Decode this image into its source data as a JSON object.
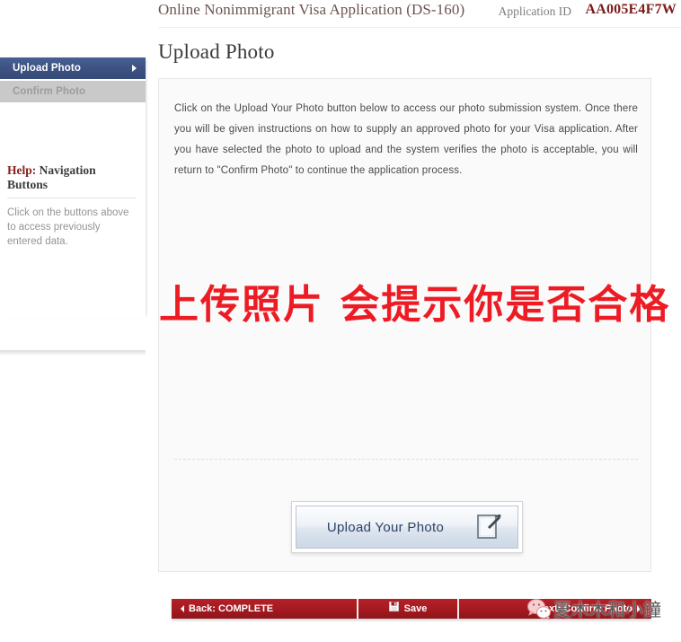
{
  "header": {
    "title": "Online Nonimmigrant Visa Application (DS-160)",
    "app_id_label": "Application ID",
    "app_id_value": "AA005E4F7W"
  },
  "sidebar": {
    "nav_items": [
      {
        "label": "Upload Photo",
        "state": "active"
      },
      {
        "label": "Confirm Photo",
        "state": "disabled"
      }
    ],
    "help": {
      "title_accent": "Help:",
      "title_rest": " Navigation Buttons",
      "body": "Click on the buttons above to access previously entered data."
    }
  },
  "main": {
    "page_title": "Upload Photo",
    "instructions": "Click on the Upload Your Photo button below to access our photo submission system. Once there you will be given instructions on how to supply an approved photo for your Visa application. After you have selected the photo to upload and the system verifies the photo is acceptable, you will return to \"Confirm Photo\" to continue the application process.",
    "overlay_note": "上传照片  会提示你是否合格",
    "upload_button_label": "Upload Your Photo"
  },
  "toolbar": {
    "back_label": "Back: COMPLETE",
    "save_label": "Save",
    "next_label": "Next: Confirm Photo"
  },
  "watermark": {
    "text": "夏木木和小鐘"
  },
  "colors": {
    "nav_active": "#3d5283",
    "nav_disabled": "#c9c9c9",
    "toolbar_red": "#a31a20",
    "app_id_red": "#7c1b1b",
    "overlay_red": "#ed1c24"
  }
}
